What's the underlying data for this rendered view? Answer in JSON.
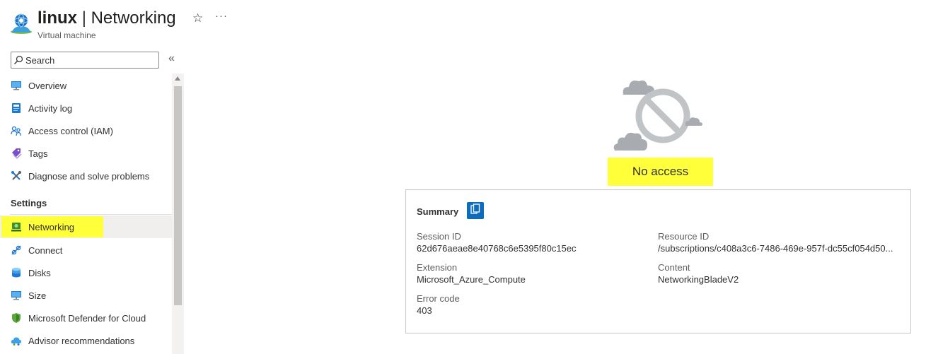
{
  "header": {
    "resource_name": "linux",
    "separator": "|",
    "page_name": "Networking",
    "subtitle": "Virtual machine",
    "star_glyph": "☆",
    "more_glyph": "···"
  },
  "sidebar": {
    "search_placeholder": "Search",
    "collapse_glyph": "«",
    "items": [
      {
        "label": "Overview",
        "icon": "monitor-icon"
      },
      {
        "label": "Activity log",
        "icon": "log-icon"
      },
      {
        "label": "Access control (IAM)",
        "icon": "people-icon"
      },
      {
        "label": "Tags",
        "icon": "tag-icon"
      },
      {
        "label": "Diagnose and solve problems",
        "icon": "wrench-icon"
      }
    ],
    "settings_heading": "Settings",
    "settings_items": [
      {
        "label": "Networking",
        "icon": "network-icon",
        "active": true
      },
      {
        "label": "Connect",
        "icon": "connect-icon"
      },
      {
        "label": "Disks",
        "icon": "disks-icon"
      },
      {
        "label": "Size",
        "icon": "monitor-icon"
      },
      {
        "label": "Microsoft Defender for Cloud",
        "icon": "shield-icon"
      },
      {
        "label": "Advisor recommendations",
        "icon": "advisor-icon"
      }
    ]
  },
  "main": {
    "no_access_text": "No access",
    "summary": {
      "title": "Summary",
      "session_id_label": "Session ID",
      "session_id_value": "62d676aeae8e40768c6e5395f80c15ec",
      "extension_label": "Extension",
      "extension_value": "Microsoft_Azure_Compute",
      "error_code_label": "Error code",
      "error_code_value": "403",
      "resource_id_label": "Resource ID",
      "resource_id_value": "/subscriptions/c408a3c6-7486-469e-957f-dc55cf054d50...",
      "content_label": "Content",
      "content_value": "NetworkingBladeV2"
    }
  },
  "colors": {
    "highlight": "#ffff3a",
    "azure_blue": "#0f6cbd",
    "cloud_gray": "#a8acb1",
    "active_bg": "#f0efee"
  }
}
